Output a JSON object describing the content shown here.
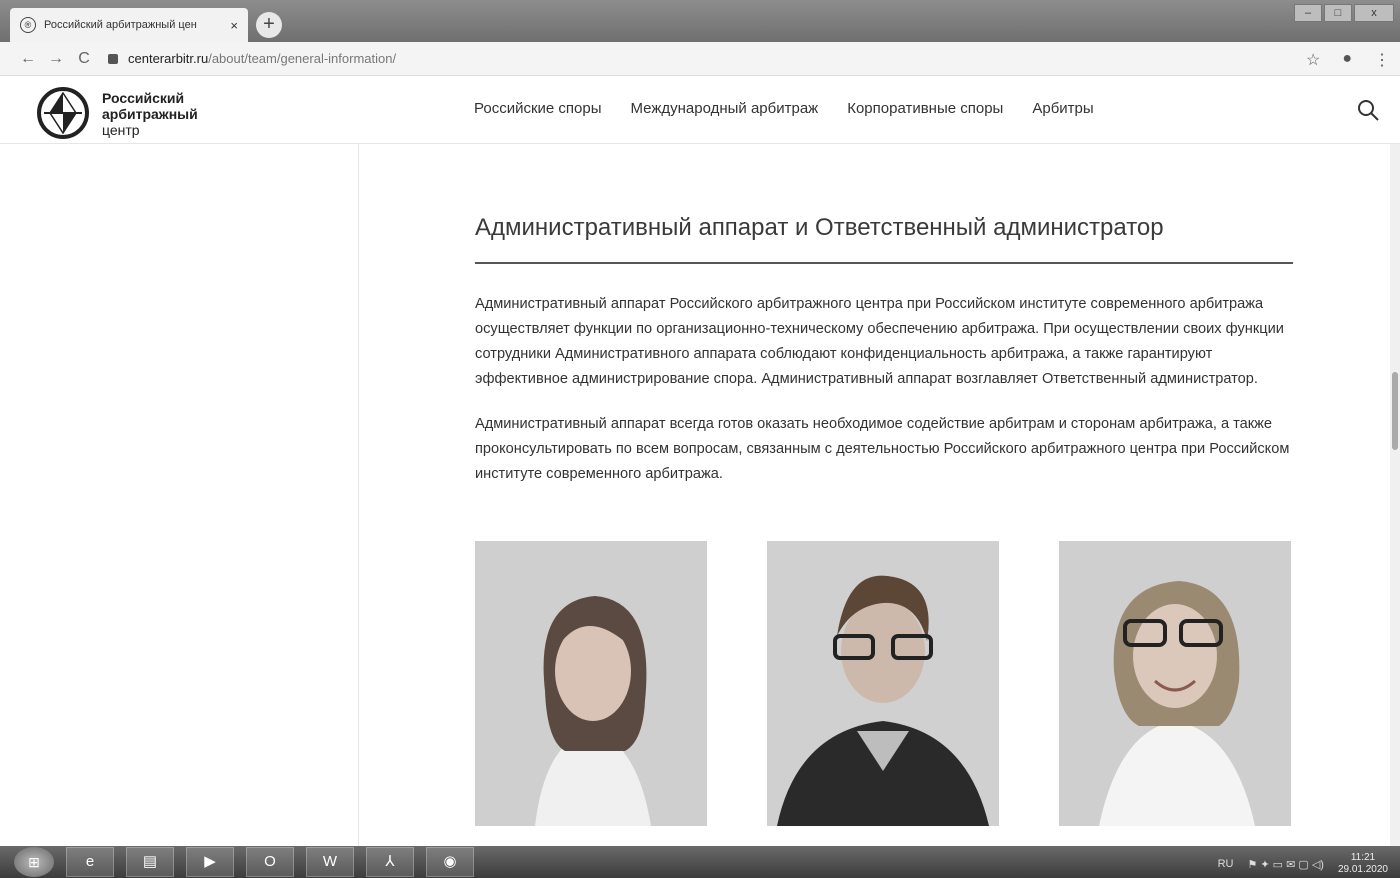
{
  "browser": {
    "tab_title": "Российский арбитражный цен",
    "tab_close": "×",
    "new_tab": "+",
    "url_host": "centerarbitr.ru",
    "url_path": "/about/team/general-information/",
    "window_controls": [
      "–",
      "□",
      "x"
    ]
  },
  "site": {
    "logo": {
      "line1": "Российский",
      "line2": "арбитражный",
      "line3": "центр"
    },
    "menu": [
      "Российские споры",
      "Международный арбитраж",
      "Корпоративные споры",
      "Арбитры"
    ]
  },
  "content": {
    "title": "Административный аппарат и Ответственный администратор",
    "paragraph1": "Административный аппарат Российского арбитражного центра при Российском институте современного арбитража осуществляет функции по организационно-техническому обеспечению арбитража. При осуществлении своих функции сотрудники Административного аппарата соблюдают конфиденциальность арбитража, а также гарантируют эффективное администрирование спора. Административный аппарат возглавляет Ответственный администратор.",
    "paragraph2": "Административный аппарат всегда готов оказать необходимое содействие арбитрам и сторонам арбитража, а также проконсультировать по всем вопросам, связанным с деятельностью Российского арбитражного центра при Российском институте современного арбитража."
  },
  "taskbar": {
    "items": [
      "e",
      "▤",
      "▶",
      "O",
      "W",
      "⅄",
      "◉"
    ],
    "lang": "RU",
    "time": "11:21",
    "date": "29.01.2020"
  },
  "icons": {
    "back": "arrow-left-icon",
    "forward": "arrow-right-icon",
    "reload": "reload-icon",
    "bookmark": "star-icon",
    "profile": "profile-icon",
    "menu": "kebab-menu-icon",
    "search": "search-icon"
  }
}
